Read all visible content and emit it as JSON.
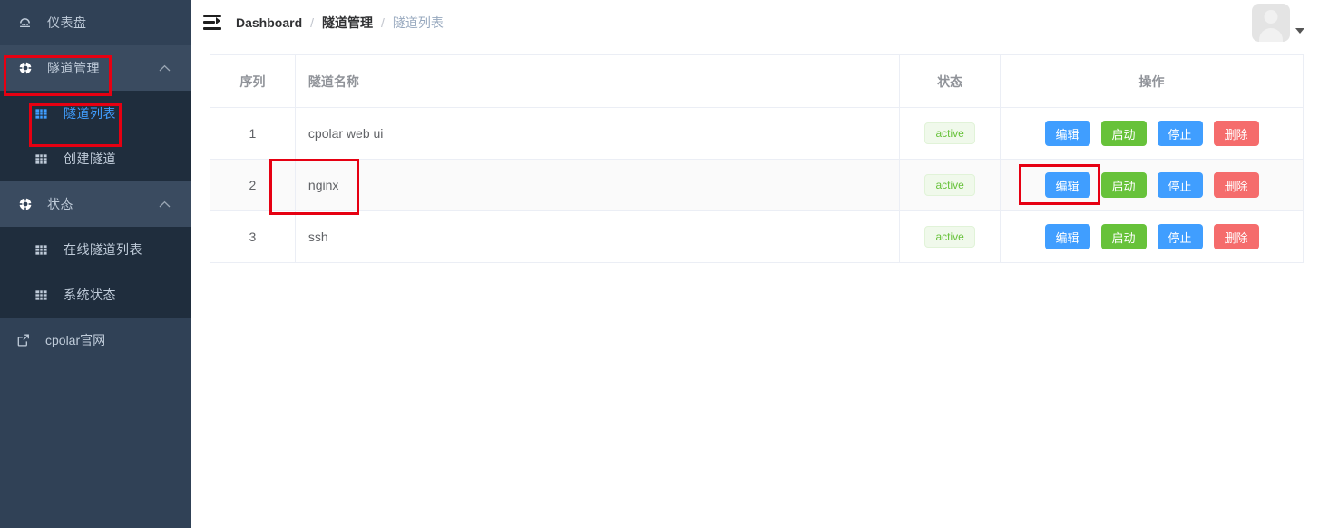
{
  "sidebar": {
    "dashboard": {
      "label": "仪表盘",
      "icon": "gauge-icon"
    },
    "groups": [
      {
        "label": "隧道管理",
        "icon": "compass-icon",
        "chevron": "chevron-up-icon",
        "expanded": true,
        "items": [
          {
            "label": "隧道列表",
            "icon": "grid-icon",
            "active": true
          },
          {
            "label": "创建隧道",
            "icon": "grid-icon",
            "active": false
          }
        ]
      },
      {
        "label": "状态",
        "icon": "compass-icon",
        "chevron": "chevron-up-icon",
        "expanded": true,
        "items": [
          {
            "label": "在线隧道列表",
            "icon": "grid-icon",
            "active": false
          },
          {
            "label": "系统状态",
            "icon": "grid-icon",
            "active": false
          }
        ]
      }
    ],
    "external_link": {
      "label": "cpolar官网",
      "icon": "external-link-icon"
    }
  },
  "navbar": {
    "hamburger": "hamburger-icon",
    "breadcrumb": [
      {
        "text": "Dashboard",
        "muted": false
      },
      {
        "text": "隧道管理",
        "muted": false
      },
      {
        "text": "隧道列表",
        "muted": true
      }
    ],
    "separator": "/",
    "avatar": "avatar",
    "caret": "chevron-down-icon"
  },
  "table": {
    "columns": [
      "序列",
      "隧道名称",
      "状态",
      "操作"
    ],
    "rows": [
      {
        "seq": "1",
        "name": "cpolar web ui",
        "status": "active",
        "actions": [
          "编辑",
          "启动",
          "停止",
          "删除"
        ]
      },
      {
        "seq": "2",
        "name": "nginx",
        "status": "active",
        "actions": [
          "编辑",
          "启动",
          "停止",
          "删除"
        ]
      },
      {
        "seq": "3",
        "name": "ssh",
        "status": "active",
        "actions": [
          "编辑",
          "启动",
          "停止",
          "删除"
        ]
      }
    ]
  },
  "colors": {
    "sidebar_bg": "#304156",
    "submenu_bg": "#1f2d3d",
    "accent_blue": "#409EFF",
    "success_green": "#67C23A",
    "danger_red": "#F56C6C",
    "annotation_red": "#e60012"
  }
}
